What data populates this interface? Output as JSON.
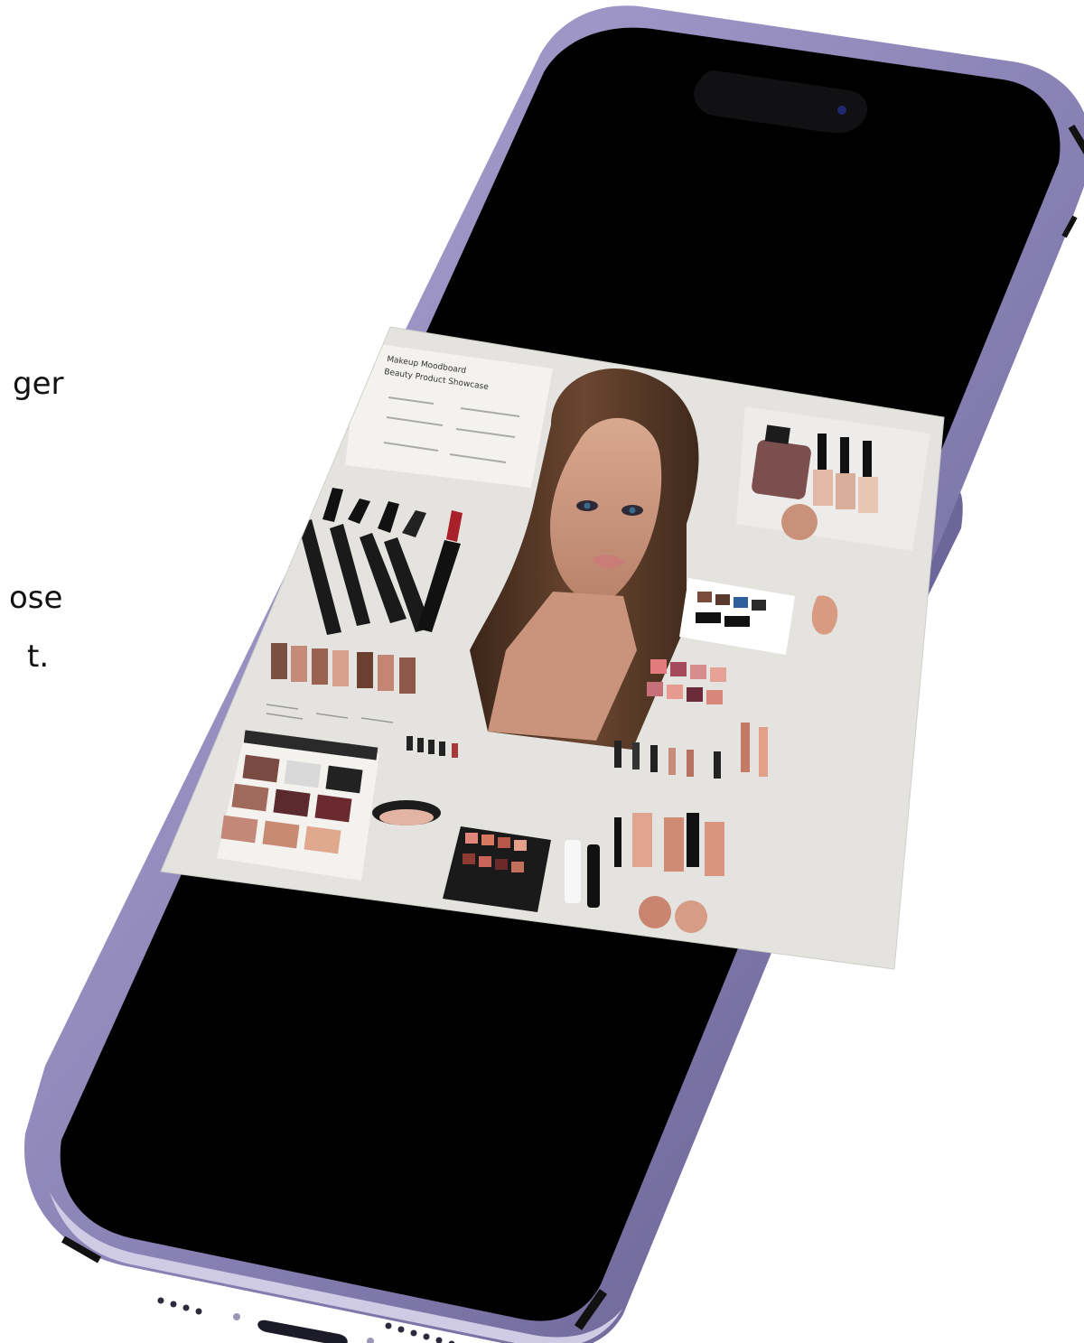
{
  "copy": {
    "line1": "ger",
    "line2": "ose",
    "line3": "t."
  },
  "screen_card": {
    "headline_line1": "Makeup Moodboard",
    "headline_line2": "Beauty Product Showcase"
  },
  "colors": {
    "frame": "#8a83b4",
    "frame_dark": "#4f4a75",
    "screen": "#000000",
    "card_bg": "#e4e3df",
    "skin": "#c99479",
    "hair": "#5a3a27",
    "lip": "#c97d76",
    "accent_red": "#a8202a"
  },
  "icons": {
    "camera": "front-camera-icon",
    "usb": "usb-c-port-icon"
  }
}
